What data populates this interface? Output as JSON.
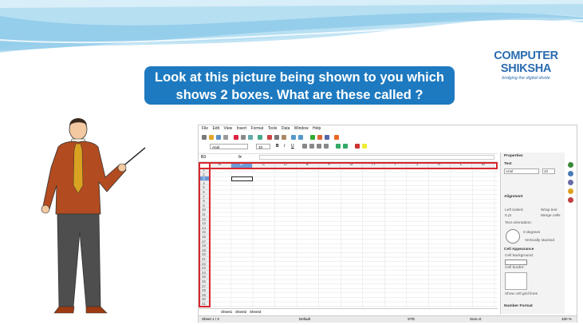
{
  "logo": {
    "main": "COMPUTER SHIKSHA",
    "tagline": "bridging the digital divide"
  },
  "question": {
    "line1": "Look at this picture being shown to you which",
    "line2": "shows 2 boxes. What are these called ?"
  },
  "app": {
    "menu": [
      "File",
      "Edit",
      "View",
      "Insert",
      "Format",
      "Tools",
      "Data",
      "Window",
      "Help"
    ],
    "font_name": "Arial",
    "font_size": "10",
    "name_box": "B3",
    "fx": "fx",
    "columns": [
      "A",
      "B",
      "C",
      "D",
      "E",
      "F",
      "G",
      "H",
      "I",
      "J",
      "K",
      "L",
      "M"
    ],
    "rows": [
      "1",
      "2",
      "3",
      "4",
      "5",
      "6",
      "7",
      "8",
      "9",
      "10",
      "11",
      "12",
      "13",
      "14",
      "15",
      "16",
      "17",
      "18",
      "19",
      "20",
      "21",
      "22",
      "23",
      "24",
      "25",
      "26",
      "27",
      "28",
      "29",
      "30",
      "31"
    ],
    "sheet_tabs": [
      "Sheet1",
      "Sheet2",
      "Sheet3"
    ],
    "status": {
      "sheet": "Sheet 1 / 3",
      "style": "Default",
      "std": "STD",
      "sum": "Sum=0",
      "zoom": "100 %"
    },
    "sidebar": {
      "title": "Properties",
      "text_section": "Text",
      "font": "Arial",
      "size": "10",
      "alignment_section": "Alignment",
      "left_indent": "Left indent:",
      "indent_value": "0 pt",
      "wrap_text": "Wrap text",
      "merge_cells": "Merge cells",
      "text_orientation": "Text orientation:",
      "degrees": "0 degrees",
      "vertically_stacked": "Vertically stacked",
      "cell_appearance": "Cell Appearance",
      "cell_background": "Cell background:",
      "cell_border": "Cell border:",
      "show_grid": "Show cell grid lines",
      "number_format": "Number Format"
    }
  },
  "colors": {
    "accent": "#1d7ac0",
    "highlight": "#d8262e"
  }
}
